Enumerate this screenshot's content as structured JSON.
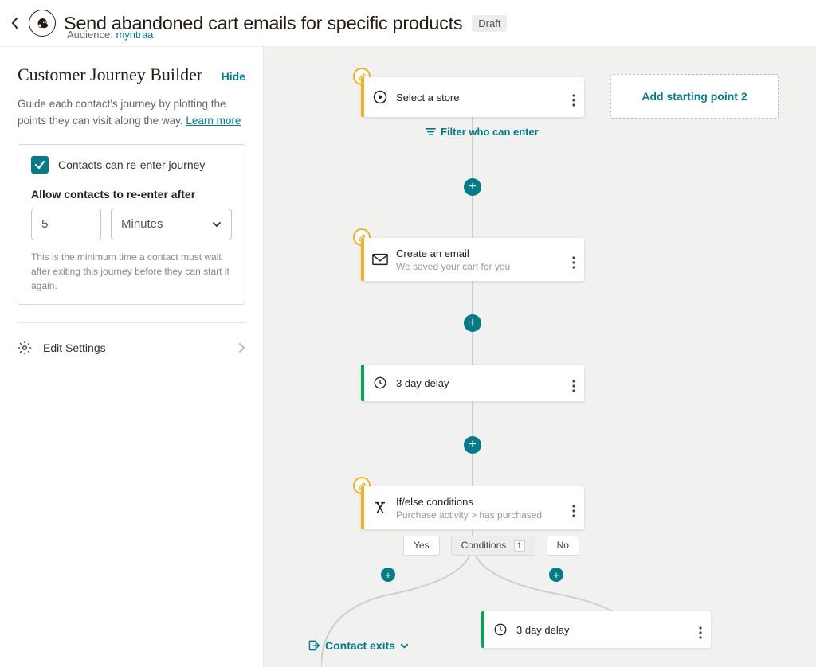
{
  "header": {
    "title": "Send abandoned cart emails for specific products",
    "status_badge": "Draft",
    "audience_label": "Audience:",
    "audience_name": "myntraa"
  },
  "sidebar": {
    "title": "Customer Journey Builder",
    "hide_label": "Hide",
    "desc_before": "Guide each contact's journey by plotting the points they can visit along the way. ",
    "learn_more": "Learn more",
    "reenter_checkbox_label": "Contacts can re-enter journey",
    "allow_label": "Allow contacts to re-enter after",
    "reenter_value": "5",
    "reenter_unit": "Minutes",
    "helper_text": "This is the minimum time a contact must wait after exiting this journey before they can start it again.",
    "edit_settings_label": "Edit Settings"
  },
  "canvas": {
    "add_starting_point_label": "Add starting point 2",
    "filter_label": "Filter who can enter",
    "contact_exits_label": "Contact exits",
    "nodes": {
      "select_store": {
        "title": "Select a store"
      },
      "create_email": {
        "title": "Create an email",
        "subtitle": "We saved your cart for you"
      },
      "delay1": {
        "title": "3 day delay"
      },
      "if_else": {
        "title": "If/else conditions",
        "subtitle": "Purchase activity > has purchased"
      },
      "delay2": {
        "title": "3 day delay"
      }
    },
    "conditions": {
      "yes": "Yes",
      "conditions_label": "Conditions",
      "conditions_count": "1",
      "no": "No"
    }
  }
}
